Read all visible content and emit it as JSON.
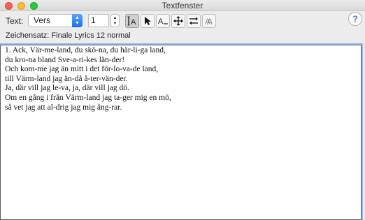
{
  "window": {
    "title": "Textfenster"
  },
  "toolbar": {
    "text_label": "Text:",
    "text_type_selected": "Vers",
    "verse_number": "1",
    "charset_label": "Zeichensatz: Finale Lyrics 12 normal",
    "tools": [
      {
        "name": "type-into-score-icon",
        "active": true
      },
      {
        "name": "select-pointer-icon",
        "active": false
      },
      {
        "name": "text-baseline-icon",
        "active": false
      },
      {
        "name": "move-arrows-icon",
        "active": false
      },
      {
        "name": "shift-lyrics-icon",
        "active": false
      },
      {
        "name": "text-style-icon",
        "active": false
      }
    ],
    "help_label": "?"
  },
  "lyrics": {
    "lines": [
      "1. Ack, Vär-me-land, du skö-na, du här-li-ga land,",
      "du kro-na bland Sve-a-ri-kes län-der!",
      "Och kom-me jag än mitt i det för-lo-va-de land,",
      "till Värm-land jag än-då å-ter-vän-der.",
      "Ja, där vill jag le-va, ja, där vill jag dö.",
      "Om en gång i från Värm-land jag ta-ger mig en mö,",
      "så vet jag att al-drig jag mig ång-rar."
    ]
  }
}
